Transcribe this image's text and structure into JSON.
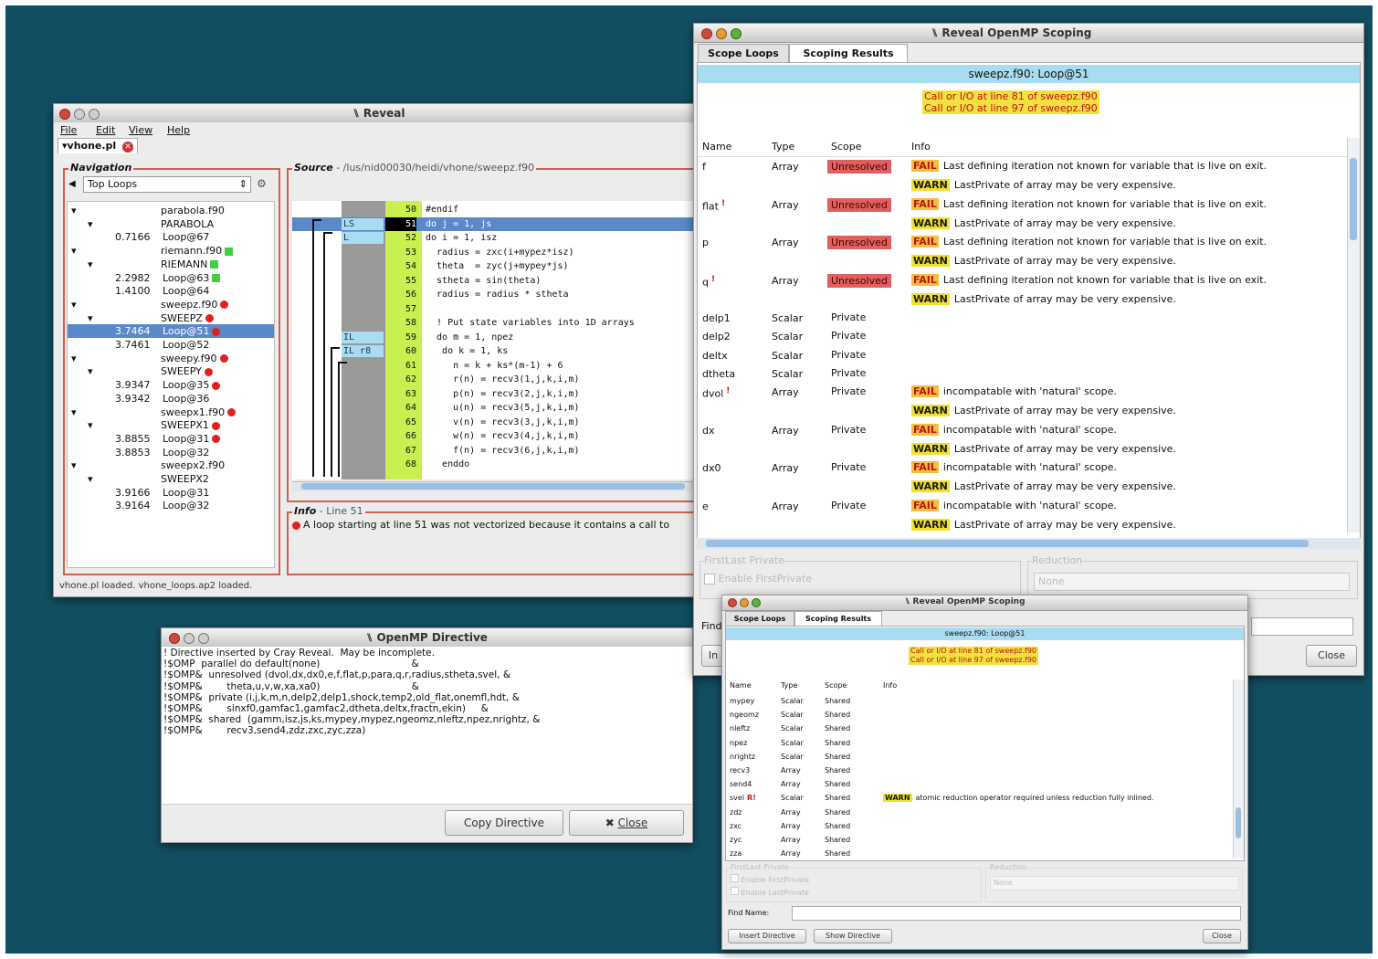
{
  "reveal": {
    "title": "Reveal",
    "menu": [
      "File",
      "Edit",
      "View",
      "Help"
    ],
    "file_tab": "vhone.pl",
    "nav_label": "Navigation",
    "nav_select": "Top Loops",
    "source_label": "Source",
    "source_path": "- /lus/nid00030/heidi/vhone/sweepz.f90",
    "nav_items": [
      {
        "prefix": "",
        "label": "parabola.f90",
        "indent": 1,
        "marker": ""
      },
      {
        "prefix": "",
        "label": "PARABOLA",
        "indent": 2,
        "marker": ""
      },
      {
        "prefix": "0.7166",
        "label": "Loop@67",
        "indent": 0,
        "marker": ""
      },
      {
        "prefix": "",
        "label": "riemann.f90",
        "indent": 1,
        "marker": "green"
      },
      {
        "prefix": "",
        "label": "RIEMANN",
        "indent": 2,
        "marker": "green"
      },
      {
        "prefix": "2.2982",
        "label": "Loop@63",
        "indent": 0,
        "marker": "green"
      },
      {
        "prefix": "1.4100",
        "label": "Loop@64",
        "indent": 0,
        "marker": ""
      },
      {
        "prefix": "",
        "label": "sweepz.f90",
        "indent": 1,
        "marker": "red"
      },
      {
        "prefix": "",
        "label": "SWEEPZ",
        "indent": 2,
        "marker": "red"
      },
      {
        "prefix": "3.7464",
        "label": "Loop@51",
        "indent": 0,
        "marker": "red"
      },
      {
        "prefix": "3.7461",
        "label": "Loop@52",
        "indent": 0,
        "marker": ""
      },
      {
        "prefix": "",
        "label": "sweepy.f90",
        "indent": 1,
        "marker": "red"
      },
      {
        "prefix": "",
        "label": "SWEEPY",
        "indent": 2,
        "marker": "red"
      },
      {
        "prefix": "3.9347",
        "label": "Loop@35",
        "indent": 0,
        "marker": "red"
      },
      {
        "prefix": "3.9342",
        "label": "Loop@36",
        "indent": 0,
        "marker": ""
      },
      {
        "prefix": "",
        "label": "sweepx1.f90",
        "indent": 1,
        "marker": "red"
      },
      {
        "prefix": "",
        "label": "SWEEPX1",
        "indent": 2,
        "marker": "red"
      },
      {
        "prefix": "3.8855",
        "label": "Loop@31",
        "indent": 0,
        "marker": "red"
      },
      {
        "prefix": "3.8853",
        "label": "Loop@32",
        "indent": 0,
        "marker": ""
      },
      {
        "prefix": "",
        "label": "sweepx2.f90",
        "indent": 1,
        "marker": ""
      },
      {
        "prefix": "",
        "label": "SWEEPX2",
        "indent": 2,
        "marker": ""
      },
      {
        "prefix": "3.9166",
        "label": "Loop@31",
        "indent": 0,
        "marker": ""
      },
      {
        "prefix": "3.9164",
        "label": "Loop@32",
        "indent": 0,
        "marker": ""
      }
    ],
    "source_lines": [
      {
        "tag": "",
        "num": "50",
        "code": "#endif"
      },
      {
        "tag": "LS",
        "num": "51",
        "code": "do j = 1, js"
      },
      {
        "tag": "L",
        "num": "52",
        "code": "do i = 1, isz"
      },
      {
        "tag": "",
        "num": "53",
        "code": "  radius = zxc(i+mypez*isz)"
      },
      {
        "tag": "",
        "num": "54",
        "code": "  theta  = zyc(j+mypey*js)"
      },
      {
        "tag": "",
        "num": "55",
        "code": "  stheta = sin(theta)"
      },
      {
        "tag": "",
        "num": "56",
        "code": "  radius = radius * stheta"
      },
      {
        "tag": "",
        "num": "57",
        "code": ""
      },
      {
        "tag": "",
        "num": "58",
        "code": "  ! Put state variables into 1D arrays"
      },
      {
        "tag": "IL",
        "num": "59",
        "code": "  do m = 1, npez"
      },
      {
        "tag": "IL r8",
        "num": "60",
        "code": "   do k = 1, ks"
      },
      {
        "tag": "",
        "num": "61",
        "code": "     n = k + ks*(m-1) + 6"
      },
      {
        "tag": "",
        "num": "62",
        "code": "     r(n) = recv3(1,j,k,i,m)"
      },
      {
        "tag": "",
        "num": "63",
        "code": "     p(n) = recv3(2,j,k,i,m)"
      },
      {
        "tag": "",
        "num": "64",
        "code": "     u(n) = recv3(5,j,k,i,m)"
      },
      {
        "tag": "",
        "num": "65",
        "code": "     v(n) = recv3(3,j,k,i,m)"
      },
      {
        "tag": "",
        "num": "66",
        "code": "     w(n) = recv3(4,j,k,i,m)"
      },
      {
        "tag": "",
        "num": "67",
        "code": "     f(n) = recv3(6,j,k,i,m)"
      },
      {
        "tag": "",
        "num": "68",
        "code": "   enddo"
      }
    ],
    "info_label": "Info",
    "info_line": "- Line 51",
    "info_text": "A loop starting at line 51 was not vectorized because it contains a call to",
    "status": "vhone.pl loaded. vhone_loops.ap2 loaded."
  },
  "scoping": {
    "title": "Reveal OpenMP Scoping",
    "tabs": [
      "Scope Loops",
      "Scoping Results"
    ],
    "loop_title": "sweepz.f90: Loop@51",
    "warnings": [
      "Call or I/O at line 81 of sweepz.f90",
      "Call or I/O at line 97 of sweepz.f90"
    ],
    "headers": [
      "Name",
      "Type",
      "Scope",
      "Info"
    ],
    "rows": [
      {
        "name": "f",
        "mark": "",
        "type": "Array",
        "scope": "Unresolved",
        "info": [
          [
            "FAIL",
            "Last defining iteration not known for variable that is live on exit."
          ],
          [
            "WARN",
            "LastPrivate of array may be very expensive."
          ]
        ]
      },
      {
        "name": "flat",
        "mark": "!",
        "type": "Array",
        "scope": "Unresolved",
        "info": [
          [
            "FAIL",
            "Last defining iteration not known for variable that is live on exit."
          ],
          [
            "WARN",
            "LastPrivate of array may be very expensive."
          ]
        ]
      },
      {
        "name": "p",
        "mark": "",
        "type": "Array",
        "scope": "Unresolved",
        "info": [
          [
            "FAIL",
            "Last defining iteration not known for variable that is live on exit."
          ],
          [
            "WARN",
            "LastPrivate of array may be very expensive."
          ]
        ]
      },
      {
        "name": "q",
        "mark": "!",
        "type": "Array",
        "scope": "Unresolved",
        "info": [
          [
            "FAIL",
            "Last defining iteration not known for variable that is live on exit."
          ],
          [
            "WARN",
            "LastPrivate of array may be very expensive."
          ]
        ]
      },
      {
        "name": "delp1",
        "mark": "",
        "type": "Scalar",
        "scope": "Private",
        "info": []
      },
      {
        "name": "delp2",
        "mark": "",
        "type": "Scalar",
        "scope": "Private",
        "info": []
      },
      {
        "name": "deltx",
        "mark": "",
        "type": "Scalar",
        "scope": "Private",
        "info": []
      },
      {
        "name": "dtheta",
        "mark": "",
        "type": "Scalar",
        "scope": "Private",
        "info": []
      },
      {
        "name": "dvol",
        "mark": "!",
        "type": "Array",
        "scope": "Private",
        "info": [
          [
            "FAIL",
            "incompatable with 'natural' scope."
          ],
          [
            "WARN",
            "LastPrivate of array may be very expensive."
          ]
        ]
      },
      {
        "name": "dx",
        "mark": "",
        "type": "Array",
        "scope": "Private",
        "info": [
          [
            "FAIL",
            "incompatable with 'natural' scope."
          ],
          [
            "WARN",
            "LastPrivate of array may be very expensive."
          ]
        ]
      },
      {
        "name": "dx0",
        "mark": "",
        "type": "Array",
        "scope": "Private",
        "info": [
          [
            "FAIL",
            "incompatable with 'natural' scope."
          ],
          [
            "WARN",
            "LastPrivate of array may be very expensive."
          ]
        ]
      },
      {
        "name": "e",
        "mark": "",
        "type": "Array",
        "scope": "Private",
        "info": [
          [
            "FAIL",
            "incompatable with 'natural' scope."
          ],
          [
            "WARN",
            "LastPrivate of array may be very expensive."
          ]
        ]
      }
    ],
    "firstlast_label": "FirstLast Private",
    "enable_first": "Enable FirstPrivate",
    "reduction_label": "Reduction",
    "reduction_value": "None",
    "find_label": "Find",
    "insert_label": "In",
    "close": "Close"
  },
  "directive": {
    "title": "OpenMP Directive",
    "lines": [
      "! Directive inserted by Cray Reveal.  May be incomplete.",
      "!$OMP  parallel do default(none)                              &",
      "!$OMP&  unresolved (dvol,dx,dx0,e,f,flat,p,para,q,r,radius,stheta,svel, &",
      "!$OMP&        theta,u,v,w,xa,xa0)                              &",
      "!$OMP&  private (i,j,k,m,n,delp2,delp1,shock,temp2,old_flat,onemfl,hdt, &",
      "!$OMP&        sinxf0,gamfac1,gamfac2,dtheta,deltx,fractn,ekin)     &",
      "!$OMP&  shared  (gamm,isz,js,ks,mypey,mypez,ngeomz,nleftz,npez,nrightz, &",
      "!$OMP&        recv3,send4,zdz,zxc,zyc,zza)"
    ],
    "copy_button": "Copy Directive",
    "close_button": "Close"
  },
  "scoping2": {
    "title": "Reveal OpenMP Scoping",
    "tabs": [
      "Scope Loops",
      "Scoping Results"
    ],
    "loop_title": "sweepz.f90: Loop@51",
    "warnings": [
      "Call or I/O at line 81 of sweepz.f90",
      "Call or I/O at line 97 of sweepz.f90"
    ],
    "headers": [
      "Name",
      "Type",
      "Scope",
      "Info"
    ],
    "rows": [
      {
        "name": "mypey",
        "mark": "",
        "type": "Scalar",
        "scope": "Shared",
        "info": ""
      },
      {
        "name": "ngeomz",
        "mark": "",
        "type": "Scalar",
        "scope": "Shared",
        "info": ""
      },
      {
        "name": "nleftz",
        "mark": "",
        "type": "Scalar",
        "scope": "Shared",
        "info": ""
      },
      {
        "name": "npez",
        "mark": "",
        "type": "Scalar",
        "scope": "Shared",
        "info": ""
      },
      {
        "name": "nrightz",
        "mark": "",
        "type": "Scalar",
        "scope": "Shared",
        "info": ""
      },
      {
        "name": "recv3",
        "mark": "",
        "type": "Array",
        "scope": "Shared",
        "info": ""
      },
      {
        "name": "send4",
        "mark": "",
        "type": "Array",
        "scope": "Shared",
        "info": ""
      },
      {
        "name": "svel",
        "mark": "R!",
        "type": "Scalar",
        "scope": "Shared",
        "info": "atomic reduction operator required unless reduction fully inlined."
      },
      {
        "name": "zdz",
        "mark": "",
        "type": "Array",
        "scope": "Shared",
        "info": ""
      },
      {
        "name": "zxc",
        "mark": "",
        "type": "Array",
        "scope": "Shared",
        "info": ""
      },
      {
        "name": "zyc",
        "mark": "",
        "type": "Array",
        "scope": "Shared",
        "info": ""
      },
      {
        "name": "zza",
        "mark": "",
        "type": "Array",
        "scope": "Shared",
        "info": ""
      }
    ],
    "warn_tag": "WARN",
    "firstlast_label": "FirstLast Private",
    "enable_first": "Enable FirstPrivate",
    "enable_last": "Enable LastPrivate",
    "reduction_label": "Reduction",
    "reduction_value": "None",
    "find_label": "Find Name:",
    "insert_button": "Insert Directive",
    "show_button": "Show Directive",
    "close_button": "Close"
  }
}
